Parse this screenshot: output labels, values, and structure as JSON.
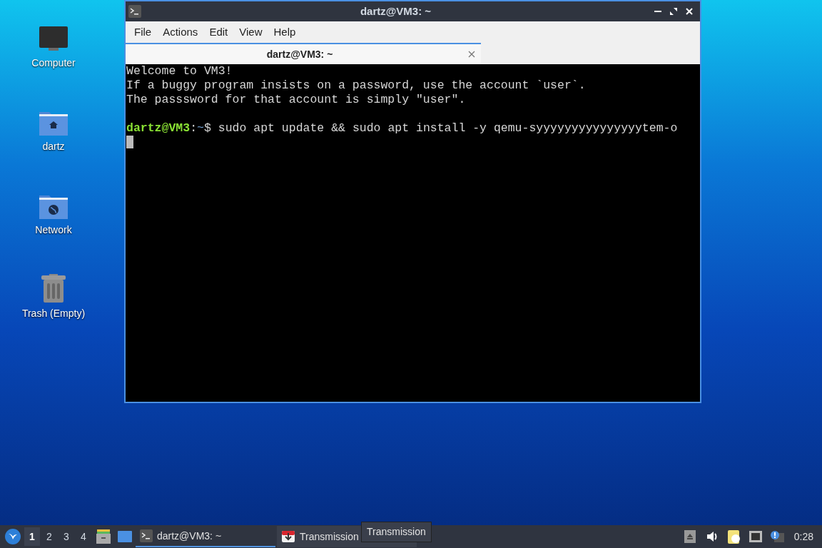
{
  "desktop_icons": [
    {
      "kind": "computer",
      "label": "Computer"
    },
    {
      "kind": "home",
      "label": "dartz"
    },
    {
      "kind": "network",
      "label": "Network"
    },
    {
      "kind": "trash",
      "label": "Trash (Empty)"
    }
  ],
  "window": {
    "title": "dartz@VM3: ~",
    "menu": [
      "File",
      "Actions",
      "Edit",
      "View",
      "Help"
    ],
    "tabs": [
      {
        "label": "dartz@VM3: ~",
        "selected": true
      }
    ],
    "terminal": {
      "lines": [
        "Welcome to VM3!",
        "If a buggy program insists on a password, use the account `user`.",
        "The passsword for that account is simply \"user\"."
      ],
      "prompt": {
        "user_host": "dartz@VM3",
        "separator": ":",
        "path": "~",
        "symbol": "$",
        "command": " sudo apt update && sudo apt install -y qemu-syyyyyyyyyyyyyyytem-o"
      }
    }
  },
  "taskbar": {
    "workspaces": [
      {
        "label": "1",
        "selected": true
      },
      {
        "label": "2",
        "selected": false
      },
      {
        "label": "3",
        "selected": false
      },
      {
        "label": "4",
        "selected": false
      }
    ],
    "tasks": [
      {
        "kind": "terminal",
        "label": "dartz@VM3: ~",
        "selected": true
      },
      {
        "kind": "transmission",
        "label": "Transmission",
        "selected": false
      }
    ],
    "tooltip": "Transmission",
    "clock": "0:28"
  }
}
